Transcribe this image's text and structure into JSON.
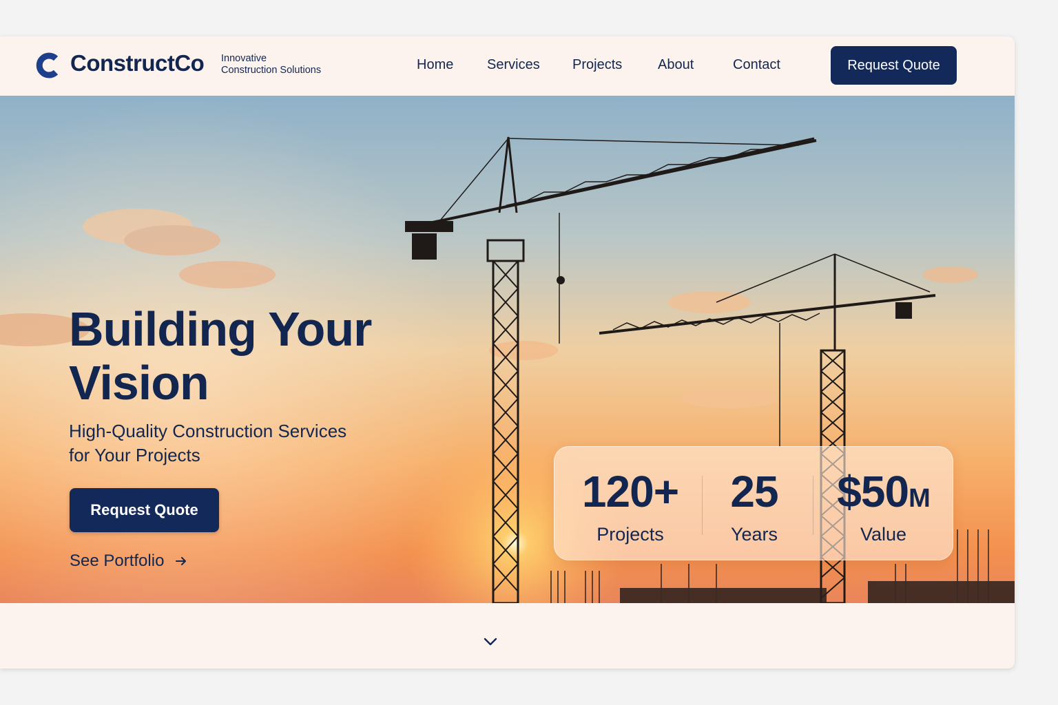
{
  "brand": {
    "name": "ConstructCo",
    "logo_letter": "C",
    "tagline_line1": "Innovative",
    "tagline_line2": "Construction Solutions"
  },
  "nav": {
    "items": [
      {
        "label": "Home"
      },
      {
        "label": "Services"
      },
      {
        "label": "Projects"
      },
      {
        "label": "About"
      },
      {
        "label": "Contact"
      }
    ],
    "cta_label": "Request Quote"
  },
  "hero": {
    "headline_line1": "Building Your",
    "headline_line2": "Vision",
    "subheadline_line1": "High-Quality Construction Services",
    "subheadline_line2": "for Your Projects",
    "cta_label": "Request Quote",
    "secondary_link": "See Portfolio",
    "secondary_icon": "arrow-right-icon"
  },
  "stats": [
    {
      "value": "120+",
      "suffix": "",
      "label": "Projects"
    },
    {
      "value": "25",
      "suffix": "",
      "label": "Years"
    },
    {
      "value": "$50",
      "suffix": "M",
      "label": "Value"
    }
  ],
  "scroll_icon": "chevron-down-icon",
  "colors": {
    "primary": "#12295a",
    "text": "#12264f",
    "page_bg": "#fdf3ee",
    "sky_top": "#8fb1c8",
    "sky_horizon": "#f49a52"
  }
}
